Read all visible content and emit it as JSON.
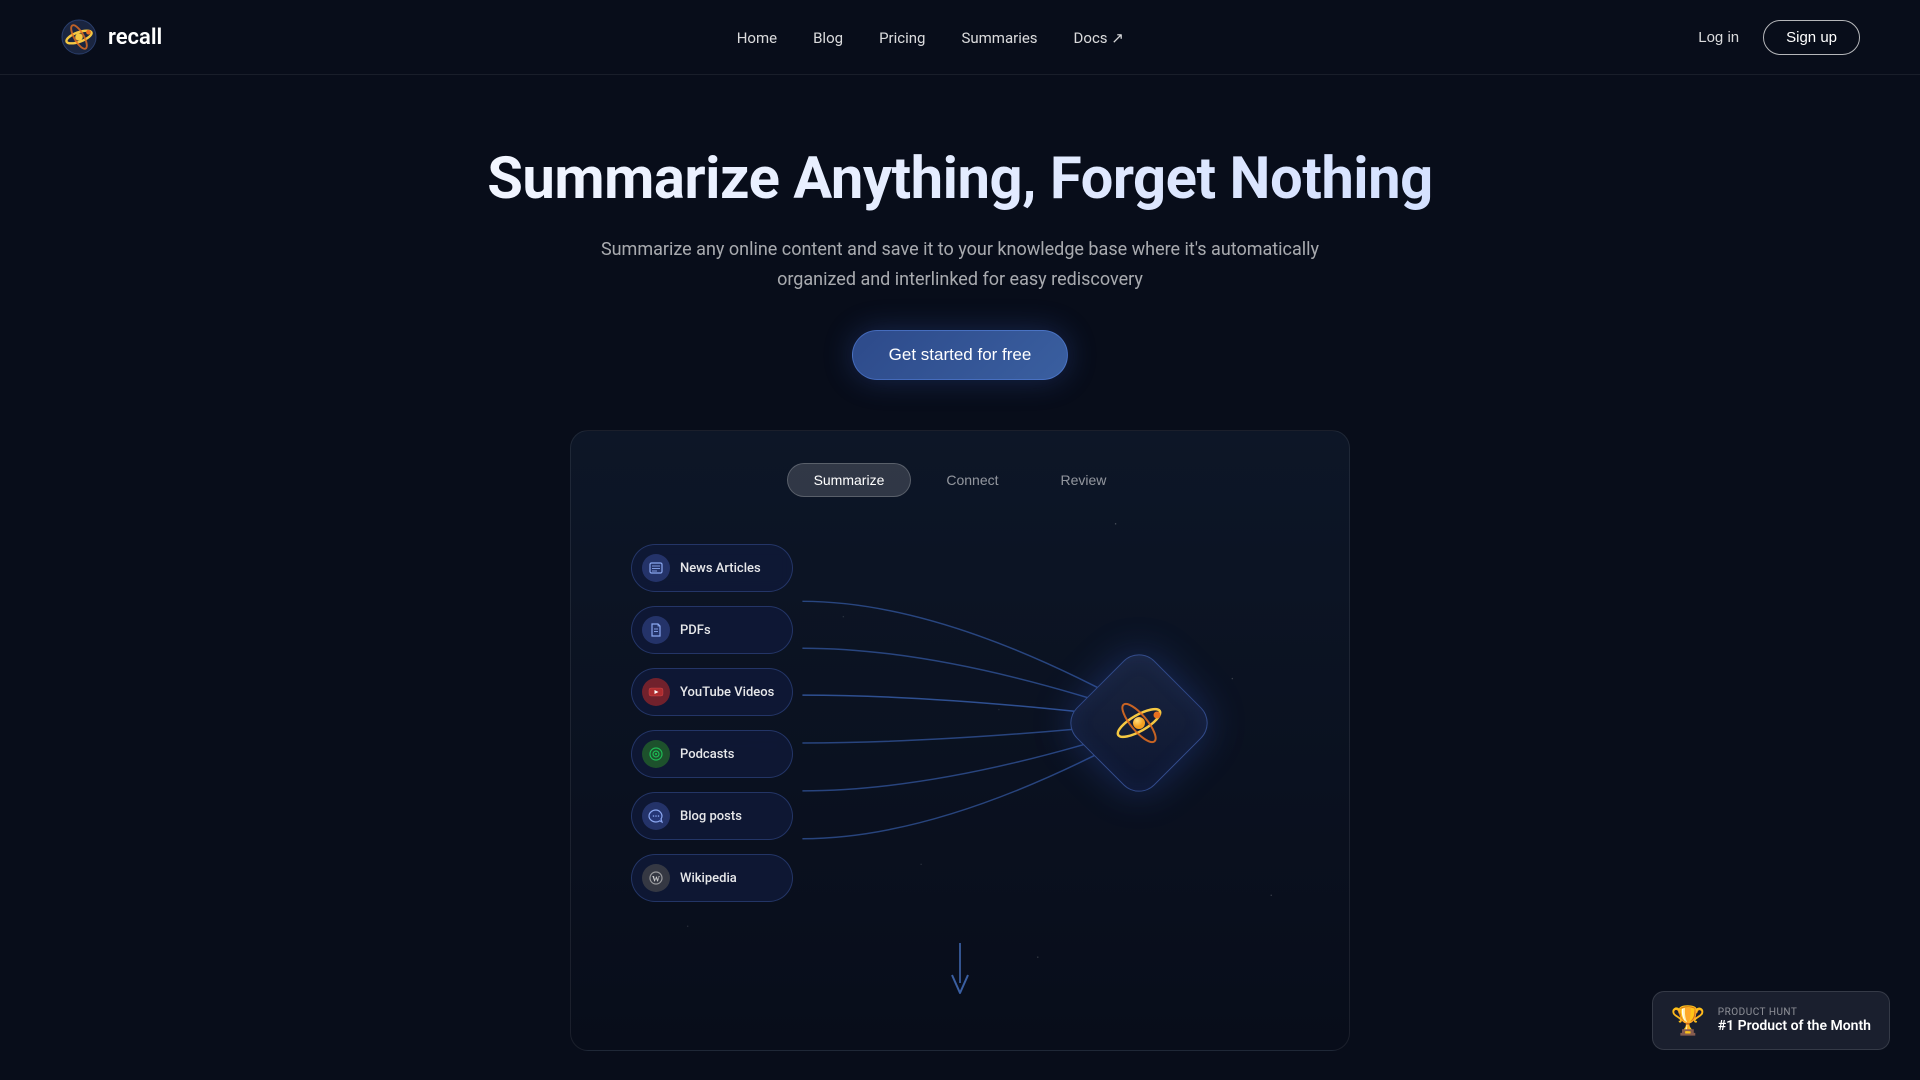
{
  "nav": {
    "logo_text": "recall",
    "links": [
      {
        "label": "Home",
        "href": "#"
      },
      {
        "label": "Blog",
        "href": "#"
      },
      {
        "label": "Pricing",
        "href": "#"
      },
      {
        "label": "Summaries",
        "href": "#"
      },
      {
        "label": "Docs ↗",
        "href": "#"
      }
    ],
    "login_label": "Log in",
    "signup_label": "Sign up"
  },
  "hero": {
    "title": "Summarize Anything, Forget Nothing",
    "subtitle": "Summarize any online content and save it to your knowledge base where it's automatically organized and interlinked for easy rediscovery",
    "cta_label": "Get started for free"
  },
  "demo": {
    "tabs": [
      {
        "label": "Summarize",
        "active": true
      },
      {
        "label": "Connect",
        "active": false
      },
      {
        "label": "Review",
        "active": false
      }
    ],
    "sources": [
      {
        "label": "News Articles",
        "icon_type": "news",
        "icon_char": "📰"
      },
      {
        "label": "PDFs",
        "icon_type": "pdf",
        "icon_char": "📄"
      },
      {
        "label": "YouTube Videos",
        "icon_type": "youtube",
        "icon_char": "▶"
      },
      {
        "label": "Podcasts",
        "icon_type": "podcast",
        "icon_char": "🎵"
      },
      {
        "label": "Blog posts",
        "icon_type": "blog",
        "icon_char": "📡"
      },
      {
        "label": "Wikipedia",
        "icon_type": "wiki",
        "icon_char": "W"
      }
    ]
  },
  "product_hunt": {
    "label": "PRODUCT HUNT",
    "title": "#1 Product of the Month"
  }
}
